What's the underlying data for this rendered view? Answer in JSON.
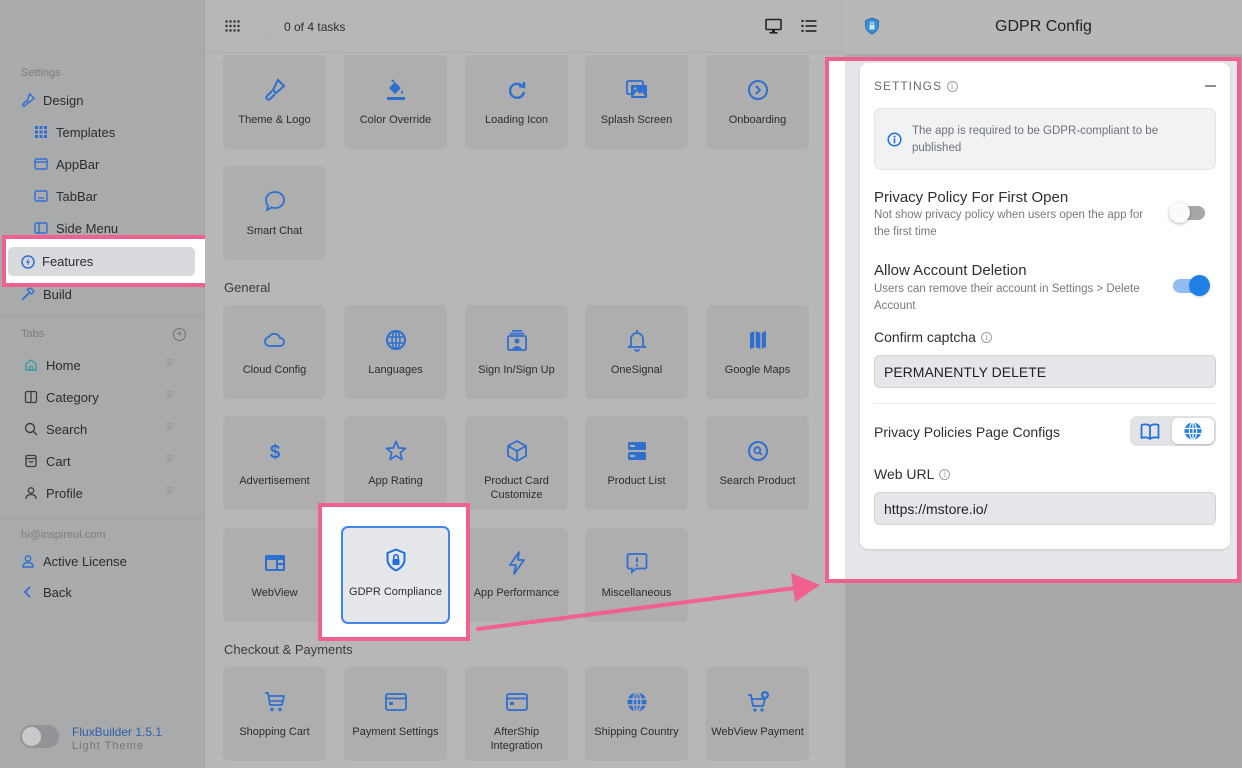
{
  "sidebar": {
    "settings_label": "Settings",
    "design": "Design",
    "design_items": [
      "Templates",
      "AppBar",
      "TabBar",
      "Side Menu"
    ],
    "features": "Features",
    "build": "Build",
    "tabs_label": "Tabs",
    "tabs": [
      "Home",
      "Category",
      "Search",
      "Cart",
      "Profile"
    ],
    "email": "hi@inspireui.com",
    "active_license": "Active License",
    "back": "Back",
    "version": "FluxBuilder 1.5.1",
    "theme": "Light Theme",
    "theme_toggle_on": false
  },
  "topbar": {
    "tasks": "0 of 4 tasks"
  },
  "main": {
    "design_tiles": [
      {
        "label": "Theme & Logo",
        "icon": "brush-icon"
      },
      {
        "label": "Color Override",
        "icon": "paint-bucket-icon"
      },
      {
        "label": "Loading Icon",
        "icon": "refresh-icon"
      },
      {
        "label": "Splash Screen",
        "icon": "images-icon"
      },
      {
        "label": "Onboarding",
        "icon": "arrow-circle-icon"
      },
      {
        "label": "Smart Chat",
        "icon": "chat-icon"
      }
    ],
    "general_label": "General",
    "general_tiles": [
      {
        "label": "Cloud Config",
        "icon": "cloud-icon"
      },
      {
        "label": "Languages",
        "icon": "globe-icon"
      },
      {
        "label": "Sign In/Sign Up",
        "icon": "user-card-icon"
      },
      {
        "label": "OneSignal",
        "icon": "bell-icon"
      },
      {
        "label": "Google Maps",
        "icon": "map-icon"
      },
      {
        "label": "Advertisement",
        "icon": "dollar-icon"
      },
      {
        "label": "App Rating",
        "icon": "star-icon"
      },
      {
        "label": "Product Card Customize",
        "icon": "cube-icon"
      },
      {
        "label": "Product List",
        "icon": "server-list-icon"
      },
      {
        "label": "Search Product",
        "icon": "search-circle-icon"
      },
      {
        "label": "WebView",
        "icon": "browser-icon"
      },
      {
        "label": "GDPR Compliance",
        "icon": "shield-lock-icon"
      },
      {
        "label": "App Performance",
        "icon": "lightning-icon"
      },
      {
        "label": "Miscellaneous",
        "icon": "alert-bubble-icon"
      }
    ],
    "checkout_label": "Checkout & Payments",
    "checkout_tiles": [
      {
        "label": "Shopping Cart",
        "icon": "cart-icon"
      },
      {
        "label": "Payment Settings",
        "icon": "credit-card-icon"
      },
      {
        "label": "AfterShip Integration",
        "icon": "credit-card-icon"
      },
      {
        "label": "Shipping Country",
        "icon": "globe-icon"
      },
      {
        "label": "WebView Payment",
        "icon": "cart-plus-icon"
      }
    ]
  },
  "panel": {
    "title": "GDPR Config",
    "settings_label": "SETTINGS",
    "notice": "The app is required to be GDPR-compliant to be published",
    "privacy_first_open": {
      "title": "Privacy Policy For First Open",
      "desc": "Not show privacy policy when users open the app for the first time",
      "enabled": false
    },
    "allow_deletion": {
      "title": "Allow Account Deletion",
      "desc": "Users can remove their account in Settings > Delete Account",
      "enabled": true
    },
    "captcha_label": "Confirm captcha",
    "captcha_value": "PERMANENTLY DELETE",
    "privacy_pages_label": "Privacy Policies Page Configs",
    "privacy_pages_mode": "web",
    "web_url_label": "Web URL",
    "web_url_value": "https://mstore.io/"
  },
  "colors": {
    "accent": "#1f7fe6",
    "icon_blue": "#2f6fd0",
    "highlight": "#f0618d"
  }
}
